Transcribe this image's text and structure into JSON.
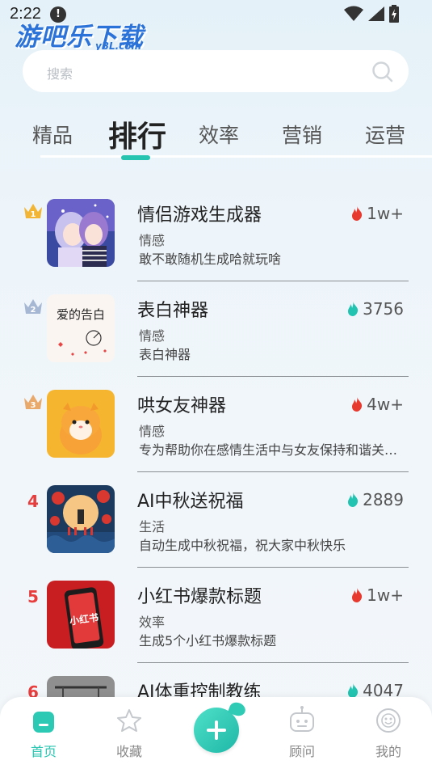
{
  "status_bar": {
    "time": "2:22",
    "alert_glyph": "!"
  },
  "watermark": {
    "main": "游吧乐下载",
    "sub": "yBL.com"
  },
  "search": {
    "placeholder": "搜索"
  },
  "tabs": [
    {
      "label": "精品"
    },
    {
      "label": "排行",
      "active": true
    },
    {
      "label": "效率"
    },
    {
      "label": "营销"
    },
    {
      "label": "运营"
    }
  ],
  "rank_colors": {
    "gold": "#f2b535",
    "silver": "#a6b7d3",
    "bronze": "#e9a96b",
    "number": "#e83d3d"
  },
  "items": [
    {
      "rank": "1",
      "title": "情侣游戏生成器",
      "category": "情感",
      "desc": "敢不敢随机生成哈就玩啥",
      "stat": "1w+",
      "stat_icon": "fire-red-icon"
    },
    {
      "rank": "2",
      "title": "表白神器",
      "category": "情感",
      "desc": "表白神器",
      "stat": "3756",
      "stat_icon": "flame-teal-icon"
    },
    {
      "rank": "3",
      "title": "哄女友神器",
      "category": "情感",
      "desc": "专为帮助你在感情生活中与女友保持和谐关…",
      "stat": "4w+",
      "stat_icon": "fire-red-icon"
    },
    {
      "rank": "4",
      "title": "AI中秋送祝福",
      "category": "生活",
      "desc": "自动生成中秋祝福，祝大家中秋快乐",
      "stat": "2889",
      "stat_icon": "flame-teal-icon"
    },
    {
      "rank": "5",
      "title": "小红书爆款标题",
      "category": "效率",
      "desc": "生成5个小红书爆款标题",
      "stat": "1w+",
      "stat_icon": "fire-red-icon"
    },
    {
      "rank": "6",
      "title": "AI体重控制教练",
      "category": "",
      "desc": "",
      "stat": "4047",
      "stat_icon": "flame-teal-icon"
    }
  ],
  "thumb_texts": {
    "love_letter": "爱的告白",
    "xiaohongshu": "小红书"
  },
  "bottom_nav": [
    {
      "label": "首页",
      "icon": "home-icon",
      "active": true
    },
    {
      "label": "收藏",
      "icon": "star-icon"
    },
    {
      "label": "",
      "icon": "add-icon"
    },
    {
      "label": "顾问",
      "icon": "robot-icon"
    },
    {
      "label": "我的",
      "icon": "smiley-icon"
    }
  ],
  "accent_color": "#25c4b0"
}
